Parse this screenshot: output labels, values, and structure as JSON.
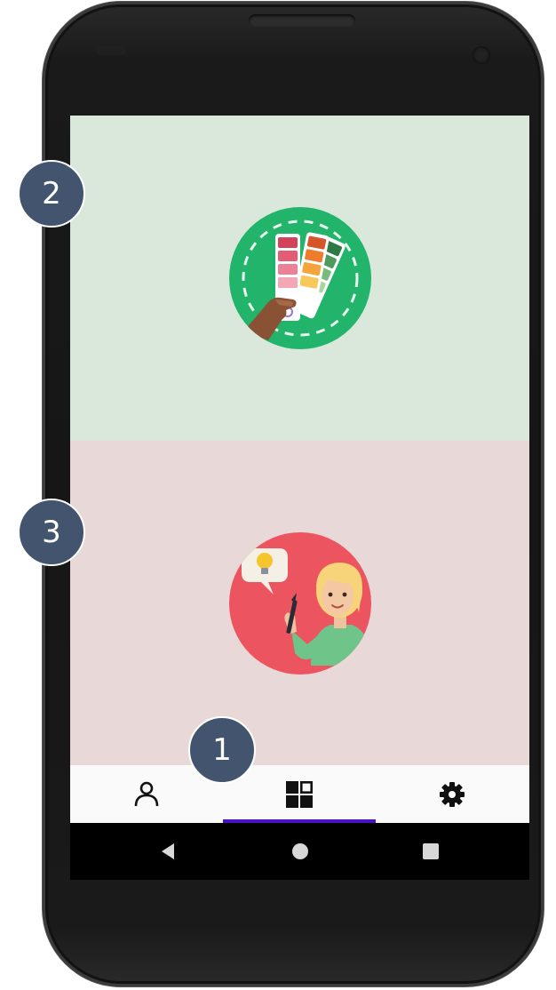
{
  "callouts": {
    "one": "1",
    "two": "2",
    "three": "3"
  },
  "colors": {
    "top_panel": "#d9e8da",
    "bottom_panel": "#e8d8d8",
    "nav_indicator": "#4a10c8",
    "callout": "#43556e"
  },
  "panels": [
    {
      "icon": "color-palette-swatch-icon"
    },
    {
      "icon": "woman-with-idea-icon"
    }
  ],
  "bottom_nav": {
    "items": [
      {
        "icon": "person-icon"
      },
      {
        "icon": "dashboard-grid-icon",
        "selected": true
      },
      {
        "icon": "gear-icon"
      }
    ]
  },
  "system_nav": {
    "items": [
      {
        "icon": "back-triangle-icon"
      },
      {
        "icon": "home-circle-icon"
      },
      {
        "icon": "recents-square-icon"
      }
    ]
  }
}
